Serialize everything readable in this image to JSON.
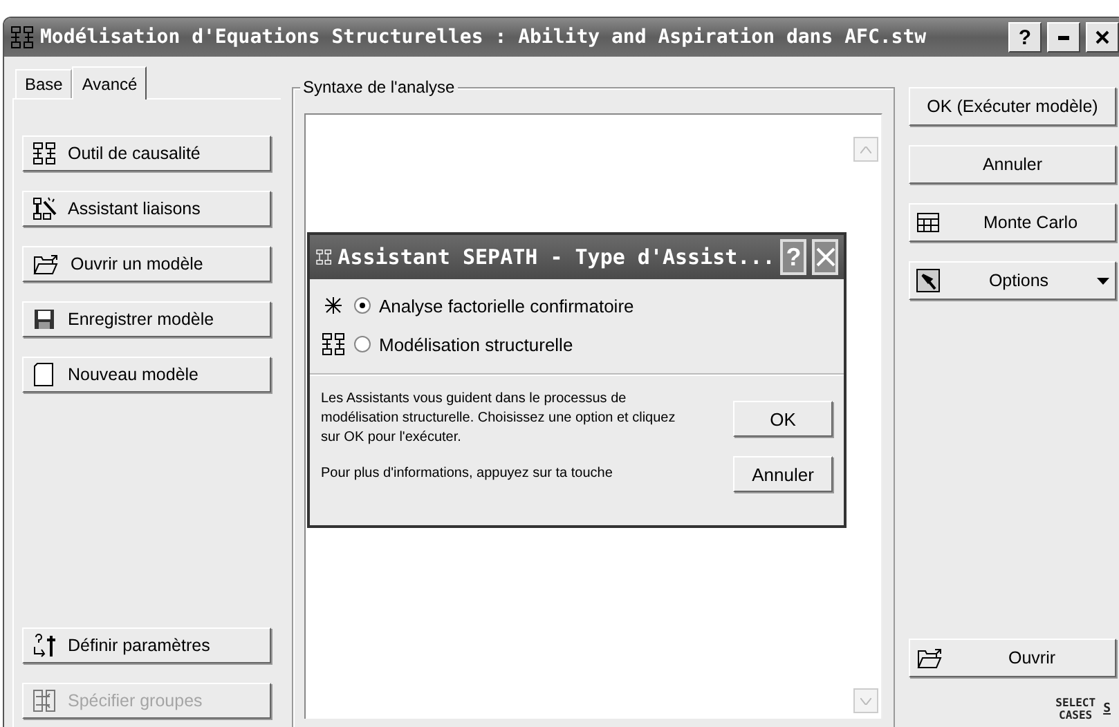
{
  "window": {
    "title": "Modélisation d'Equations Structurelles : Ability and Aspiration dans AFC.stw",
    "help": "?"
  },
  "tabs": [
    {
      "label": "Base",
      "selected": false
    },
    {
      "label": "Avancé",
      "selected": true
    }
  ],
  "left_top_buttons": [
    {
      "label": "Outil de causalité",
      "disabled": false
    },
    {
      "label": "Assistant liaisons",
      "disabled": false
    },
    {
      "label": "Ouvrir un modèle",
      "disabled": false
    },
    {
      "label": "Enregistrer modèle",
      "disabled": false
    },
    {
      "label": "Nouveau modèle",
      "disabled": false
    }
  ],
  "left_bottom_buttons": [
    {
      "label": "Définir paramètres",
      "disabled": false
    },
    {
      "label": "Spécifier groupes",
      "disabled": true
    }
  ],
  "syntax": {
    "label": "Syntaxe de l'analyse"
  },
  "right_top_buttons": [
    {
      "label": "OK (Exécuter modèle)"
    },
    {
      "label": "Annuler"
    },
    {
      "label": "Monte Carlo"
    },
    {
      "label": "Options"
    }
  ],
  "right_bottom_buttons": [
    {
      "label": "Ouvrir"
    }
  ],
  "select_cases": {
    "label": "SELECT CASES",
    "key": "S"
  },
  "dialog": {
    "title": "Assistant SEPATH - Type d'Assist...",
    "help": "?",
    "options": [
      {
        "label": "Analyse factorielle confirmatoire",
        "selected": true
      },
      {
        "label": "Modélisation structurelle",
        "selected": false
      }
    ],
    "message": "Les Assistants vous guident dans le processus de modélisation structurelle. Choisissez une option et cliquez sur OK pour l'exécuter.",
    "note": "Pour plus d'informations, appuyez sur ta touche",
    "buttons": [
      "OK",
      "Annuler"
    ]
  }
}
